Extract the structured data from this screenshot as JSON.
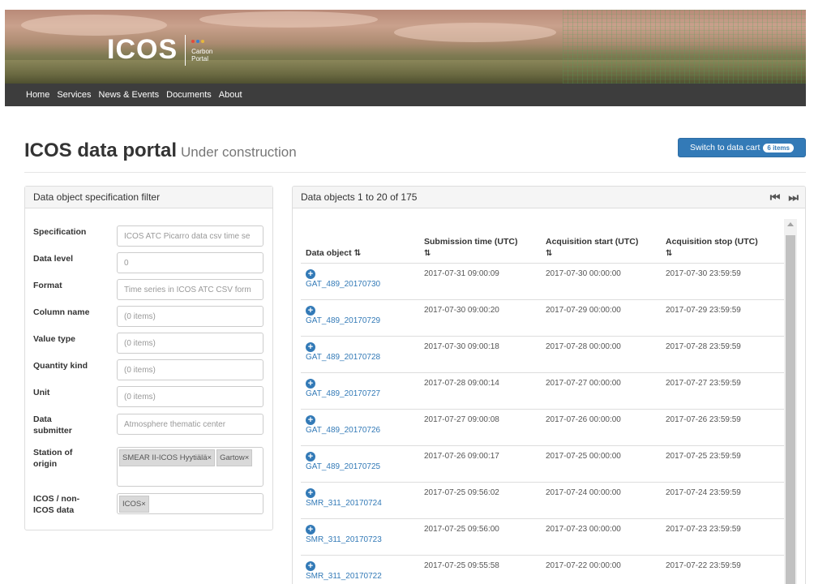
{
  "header": {
    "logo_text": "ICOS",
    "logo_sub_line1": "Carbon",
    "logo_sub_line2": "Portal",
    "dot_colors": [
      "#e64a3b",
      "#3a7fd0",
      "#e6b93b"
    ]
  },
  "nav": {
    "items": [
      "Home",
      "Services",
      "News & Events",
      "Documents",
      "About"
    ]
  },
  "page": {
    "title": "ICOS data portal",
    "subtitle": "Under construction",
    "cart_button_label": "Switch to data cart",
    "cart_badge": "6 items"
  },
  "filter": {
    "heading": "Data object specification filter",
    "fields": [
      {
        "label": "Specification",
        "value": "ICOS ATC Picarro data csv time se"
      },
      {
        "label": "Data level",
        "value": "0"
      },
      {
        "label": "Format",
        "value": "Time series in ICOS ATC CSV form"
      },
      {
        "label": "Column name",
        "value": "(0 items)"
      },
      {
        "label": "Value type",
        "value": "(0 items)"
      },
      {
        "label": "Quantity kind",
        "value": "(0 items)"
      },
      {
        "label": "Unit",
        "value": "(0 items)"
      },
      {
        "label": "Data submitter",
        "value": "Atmosphere thematic center"
      }
    ],
    "station": {
      "label": "Station of origin",
      "tags": [
        "SMEAR II-ICOS Hyytiälä×",
        "Gartow×"
      ]
    },
    "icos": {
      "label": "ICOS / non-ICOS data",
      "tags": [
        "ICOS×"
      ]
    }
  },
  "data_objects": {
    "heading": "Data objects 1 to 20 of 175",
    "columns": {
      "object": "Data object",
      "submission": "Submission time (UTC)",
      "acq_start": "Acquisition start (UTC)",
      "acq_stop": "Acquisition stop (UTC)"
    },
    "sort_glyph": "⇅",
    "rows": [
      {
        "name": "GAT_489_20170730",
        "submission": "2017-07-31 09:00:09",
        "start": "2017-07-30 00:00:00",
        "stop": "2017-07-30 23:59:59"
      },
      {
        "name": "GAT_489_20170729",
        "submission": "2017-07-30 09:00:20",
        "start": "2017-07-29 00:00:00",
        "stop": "2017-07-29 23:59:59"
      },
      {
        "name": "GAT_489_20170728",
        "submission": "2017-07-30 09:00:18",
        "start": "2017-07-28 00:00:00",
        "stop": "2017-07-28 23:59:59"
      },
      {
        "name": "GAT_489_20170727",
        "submission": "2017-07-28 09:00:14",
        "start": "2017-07-27 00:00:00",
        "stop": "2017-07-27 23:59:59"
      },
      {
        "name": "GAT_489_20170726",
        "submission": "2017-07-27 09:00:08",
        "start": "2017-07-26 00:00:00",
        "stop": "2017-07-26 23:59:59"
      },
      {
        "name": "GAT_489_20170725",
        "submission": "2017-07-26 09:00:17",
        "start": "2017-07-25 00:00:00",
        "stop": "2017-07-25 23:59:59"
      },
      {
        "name": "SMR_311_20170724",
        "submission": "2017-07-25 09:56:02",
        "start": "2017-07-24 00:00:00",
        "stop": "2017-07-24 23:59:59"
      },
      {
        "name": "SMR_311_20170723",
        "submission": "2017-07-25 09:56:00",
        "start": "2017-07-23 00:00:00",
        "stop": "2017-07-23 23:59:59"
      },
      {
        "name": "SMR_311_20170722",
        "submission": "2017-07-25 09:55:58",
        "start": "2017-07-22 00:00:00",
        "stop": "2017-07-22 23:59:59"
      }
    ]
  }
}
